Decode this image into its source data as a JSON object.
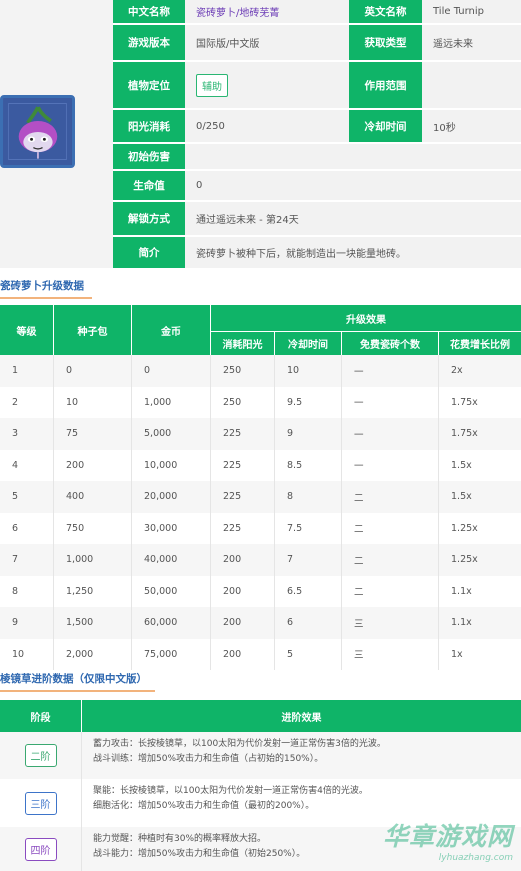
{
  "info": {
    "rows": [
      {
        "l1": "中文名称",
        "v1": "瓷砖萝卜/地砖芜菁",
        "l2": "英文名称",
        "v2": "Tile Turnip"
      },
      {
        "l1": "游戏版本",
        "v1": "国际版/中文版",
        "l2": "获取类型",
        "v2": "遥远未来"
      },
      {
        "l1": "植物定位",
        "v1": "辅助",
        "l2": "作用范围",
        "v2": ""
      },
      {
        "l1": "阳光消耗",
        "v1": "0/250",
        "l2": "冷却时间",
        "v2": "10秒"
      },
      {
        "l1": "初始伤害",
        "v1": ""
      },
      {
        "l1": "生命值",
        "v1": "0"
      },
      {
        "l1": "解锁方式",
        "v1": "通过遥远未来 - 第24天"
      },
      {
        "l1": "简介",
        "v1": "瓷砖萝卜被种下后，就能制造出一块能量地砖。"
      }
    ]
  },
  "upgrade": {
    "title": "瓷砖萝卜升级数据",
    "headers": {
      "level": "等级",
      "seed": "种子包",
      "coin": "金币",
      "effect": "升级效果",
      "sun": "消耗阳光",
      "cd": "冷却时间",
      "free": "免费瓷砖个数",
      "ratio": "花费增长比例"
    },
    "rows": [
      [
        "1",
        "0",
        "0",
        "250",
        "10",
        "一",
        "2x"
      ],
      [
        "2",
        "10",
        "1,000",
        "250",
        "9.5",
        "一",
        "1.75x"
      ],
      [
        "3",
        "75",
        "5,000",
        "225",
        "9",
        "一",
        "1.75x"
      ],
      [
        "4",
        "200",
        "10,000",
        "225",
        "8.5",
        "一",
        "1.5x"
      ],
      [
        "5",
        "400",
        "20,000",
        "225",
        "8",
        "二",
        "1.5x"
      ],
      [
        "6",
        "750",
        "30,000",
        "225",
        "7.5",
        "二",
        "1.25x"
      ],
      [
        "7",
        "1,000",
        "40,000",
        "200",
        "7",
        "二",
        "1.25x"
      ],
      [
        "8",
        "1,250",
        "50,000",
        "200",
        "6.5",
        "二",
        "1.1x"
      ],
      [
        "9",
        "1,500",
        "60,000",
        "200",
        "6",
        "三",
        "1.1x"
      ],
      [
        "10",
        "2,000",
        "75,000",
        "200",
        "5",
        "三",
        "1x"
      ]
    ]
  },
  "advance": {
    "title": "棱镜草进阶数据（仅限中文版）",
    "headers": {
      "stage": "阶段",
      "effect": "进阶效果"
    },
    "rows": [
      {
        "stage": "二阶",
        "color": "#3aa870",
        "line1": "蓄力攻击：长按棱镜草，以100太阳为代价发射一道正常伤害3倍的光波。",
        "line2": "战斗训练：增加50%攻击力和生命值（占初始的150%）。"
      },
      {
        "stage": "三阶",
        "color": "#3d74c9",
        "line1": "聚能：长按棱镜草，以100太阳为代价发射一道正常伤害4倍的光波。",
        "line2": "细胞活化：增加50%攻击力和生命值（最初的200%）。"
      },
      {
        "stage": "四阶",
        "color": "#8a4bc0",
        "line1": "能力觉醒：种植时有30%的概率释放大招。",
        "line2": "战斗能力：增加50%攻击力和生命值（初始250%）。"
      }
    ]
  },
  "watermark": {
    "brand": "华章游戏网",
    "url": "lyhuazhang.com"
  }
}
